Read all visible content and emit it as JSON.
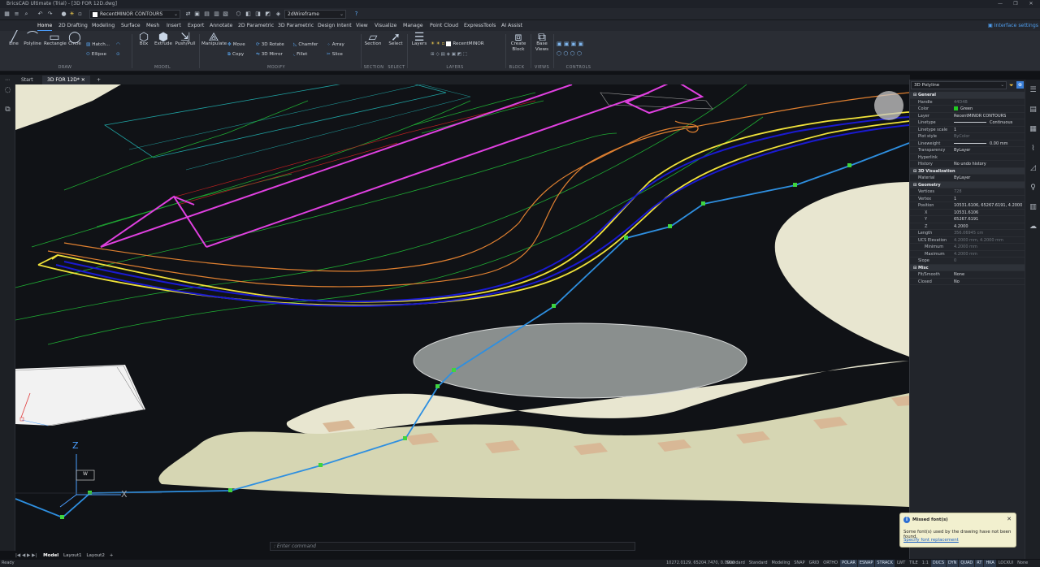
{
  "titlebar": {
    "title": "BricsCAD Ultimate (Trial) - [3D FOR 12D.dwg]",
    "minimize": "—",
    "maximize": "❐",
    "close": "✕"
  },
  "qat": {
    "layer": "RecentMINOR CONTOURS",
    "visual_style": "2dWireframe"
  },
  "menu": {
    "items": [
      "Home",
      "2D Drafting",
      "Modeling",
      "Surface",
      "Mesh",
      "Insert",
      "Export",
      "Annotate",
      "2D Parametric",
      "3D Parametric",
      "Design Intent",
      "View",
      "Visualize",
      "Manage",
      "Point Cloud",
      "ExpressTools",
      "AI Assist"
    ],
    "interface_settings": "Interface settings"
  },
  "ribbon": {
    "draw": {
      "line": "Line",
      "polyline": "Polyline",
      "rectangle": "Rectangle",
      "circle": "Circle",
      "hatch": "Hatch...",
      "ellipse": "Ellipse",
      "group": "DRAW"
    },
    "model": {
      "box": "Box",
      "extrude": "Extrude",
      "pushpull": "Push/Pull",
      "group": "MODEL"
    },
    "modify": {
      "manipulate": "Manipulate",
      "move": "Move",
      "copy": "Copy",
      "rotate3d": "3D Rotate",
      "mirror3d": "3D Mirror",
      "chamfer": "Chamfer",
      "fillet": "Fillet",
      "array": "Array",
      "slice": "Slice",
      "group": "MODIFY"
    },
    "section": {
      "label": "Section",
      "group": "SECTION"
    },
    "select": {
      "label": "Select",
      "group": "SELECT"
    },
    "layers": {
      "label": "Layers",
      "current": "RecentMINOR",
      "group": "LAYERS"
    },
    "block": {
      "label": "Create Block",
      "group": "BLOCK"
    },
    "views": {
      "label": "Base Views",
      "group": "VIEWS"
    },
    "controls": {
      "group": "CONTROLS"
    }
  },
  "doc_tabs": {
    "start": "Start",
    "active": "3D FOR 12D*",
    "add": "+"
  },
  "viewport": {
    "ucs_z": "Z",
    "ucs_x": "X",
    "ucs_w": "W"
  },
  "props": {
    "selection": "3D Polyline",
    "rows": [
      {
        "k": "General",
        "v": "",
        "sec": true
      },
      {
        "k": "Handle",
        "v": "44D4B",
        "dim": true
      },
      {
        "k": "Color",
        "v": "Green",
        "swatch": "#22cc22"
      },
      {
        "k": "Layer",
        "v": "RecentMINOR CONTOURS"
      },
      {
        "k": "Linetype",
        "v": "Continuous",
        "line": true
      },
      {
        "k": "Linetype scale",
        "v": "1"
      },
      {
        "k": "Plot style",
        "v": "ByColor",
        "dim": true
      },
      {
        "k": "Lineweight",
        "v": "0.00 mm",
        "line": true
      },
      {
        "k": "Transparency",
        "v": "ByLayer"
      },
      {
        "k": "Hyperlink",
        "v": ""
      },
      {
        "k": "History",
        "v": "No undo history"
      },
      {
        "k": "3D Visualization",
        "v": "",
        "sec": true
      },
      {
        "k": "Material",
        "v": "ByLayer"
      },
      {
        "k": "Geometry",
        "v": "",
        "sec": true
      },
      {
        "k": "Vertices",
        "v": "728",
        "dim": true
      },
      {
        "k": "Vertex",
        "v": "1"
      },
      {
        "k": "Position",
        "v": "10531.6106, 65267.6191, 4.2000",
        "sub": true
      },
      {
        "k": "X",
        "v": "10531.6106",
        "ind": true
      },
      {
        "k": "Y",
        "v": "65267.6191",
        "ind": true
      },
      {
        "k": "Z",
        "v": "4.2000",
        "ind": true
      },
      {
        "k": "Length",
        "v": "356.06945 cm",
        "dim": true
      },
      {
        "k": "UCS Elevation",
        "v": "4.2000 mm, 4.2000 mm",
        "dim": true,
        "sub": true
      },
      {
        "k": "Minimum",
        "v": "4.2000 mm",
        "dim": true,
        "ind": true
      },
      {
        "k": "Maximum",
        "v": "4.2000 mm",
        "dim": true,
        "ind": true
      },
      {
        "k": "Slope",
        "v": "0",
        "dim": true
      },
      {
        "k": "Misc",
        "v": "",
        "sec": true
      },
      {
        "k": "Fit/Smooth",
        "v": "None"
      },
      {
        "k": "Closed",
        "v": "No"
      }
    ]
  },
  "command": {
    "placeholder": ": Enter command"
  },
  "layouts": {
    "model": "Model",
    "layout1": "Layout1",
    "layout2": "Layout2"
  },
  "status": {
    "ready": "Ready",
    "coords": "10272.0129, 65204.7470, 0.0000",
    "items": [
      "Standard",
      "Standard",
      "Modeling",
      "SNAP",
      "GRID",
      "ORTHO",
      "POLAR",
      "ESNAP",
      "STRACK",
      "LWT",
      "TILE",
      "1:1",
      "DUCS",
      "DYN",
      "QUAD",
      "RT",
      "HKA",
      "LOCKUI",
      "None"
    ],
    "on": [
      "POLAR",
      "ESNAP",
      "STRACK",
      "DUCS",
      "DYN",
      "QUAD",
      "RT",
      "HKA"
    ]
  },
  "notification": {
    "title": "Missed font(s)",
    "body": "Some font(s) used by the drawing have not been found.",
    "link": "Specify font replacement",
    "close": "✕",
    "info": "i"
  },
  "colors": {
    "accent": "#4a9eff",
    "magenta": "#e040e0",
    "yellow": "#f0e23a",
    "orange": "#e08030",
    "blue": "#1a1ad0",
    "cyan_poly": "#2e8fe0",
    "green_vertex": "#3fd43f",
    "terrain": "#e8e6d0",
    "terrain_dark": "#d6d6b3"
  }
}
